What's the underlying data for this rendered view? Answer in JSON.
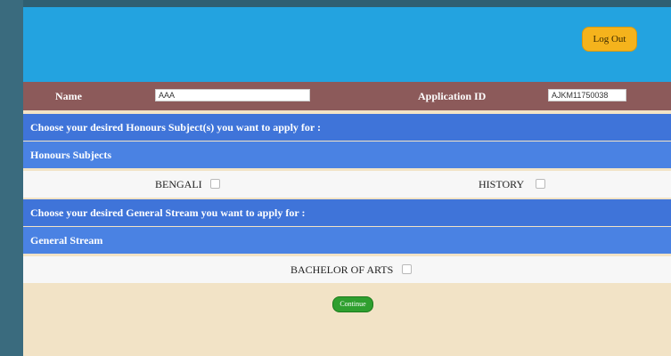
{
  "header": {
    "logout_label": "Log Out"
  },
  "info_bar": {
    "name_label": "Name",
    "name_value": "AAA",
    "app_id_label": "Application ID",
    "app_id_value": "AJKM11750038"
  },
  "honours": {
    "prompt": "Choose your desired Honours Subject(s) you want to apply for :",
    "heading": "Honours Subjects",
    "options": [
      "BENGALI",
      "HISTORY"
    ]
  },
  "general": {
    "prompt": "Choose your desired General Stream you want to apply for :",
    "heading": "General Stream",
    "options": [
      "BACHELOR OF ARTS"
    ]
  },
  "actions": {
    "continue_label": "Continue"
  }
}
